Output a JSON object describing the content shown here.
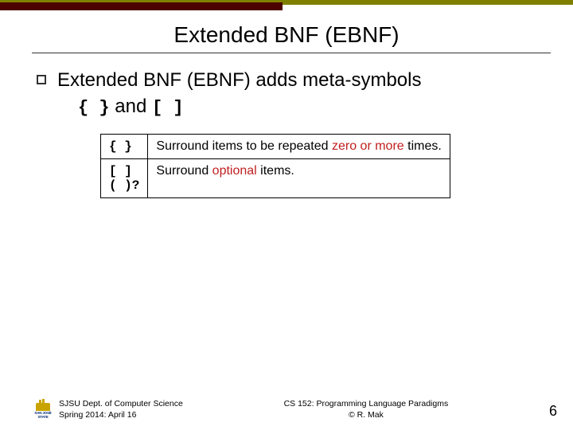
{
  "title": "Extended BNF (EBNF)",
  "bullet": {
    "line1": "Extended BNF (EBNF) adds meta-symbols",
    "sym1": "{ }",
    "mid": " and ",
    "sym2": "[ ]"
  },
  "table": {
    "rows": [
      {
        "symbol": "{ }",
        "desc_pre": "Surround items to be repeated ",
        "desc_hl": "zero or more",
        "desc_post": " times."
      },
      {
        "symbol": "[ ]\n( )?",
        "desc_pre": "Surround ",
        "desc_hl": "optional",
        "desc_post": " items."
      }
    ]
  },
  "footer": {
    "left1": "SJSU Dept. of Computer Science",
    "left2": "Spring 2014: April 16",
    "center1": "CS 152: Programming Language Paradigms",
    "center2": "© R. Mak",
    "page": "6",
    "logo_text": "SAN JOSÉ STATE"
  }
}
